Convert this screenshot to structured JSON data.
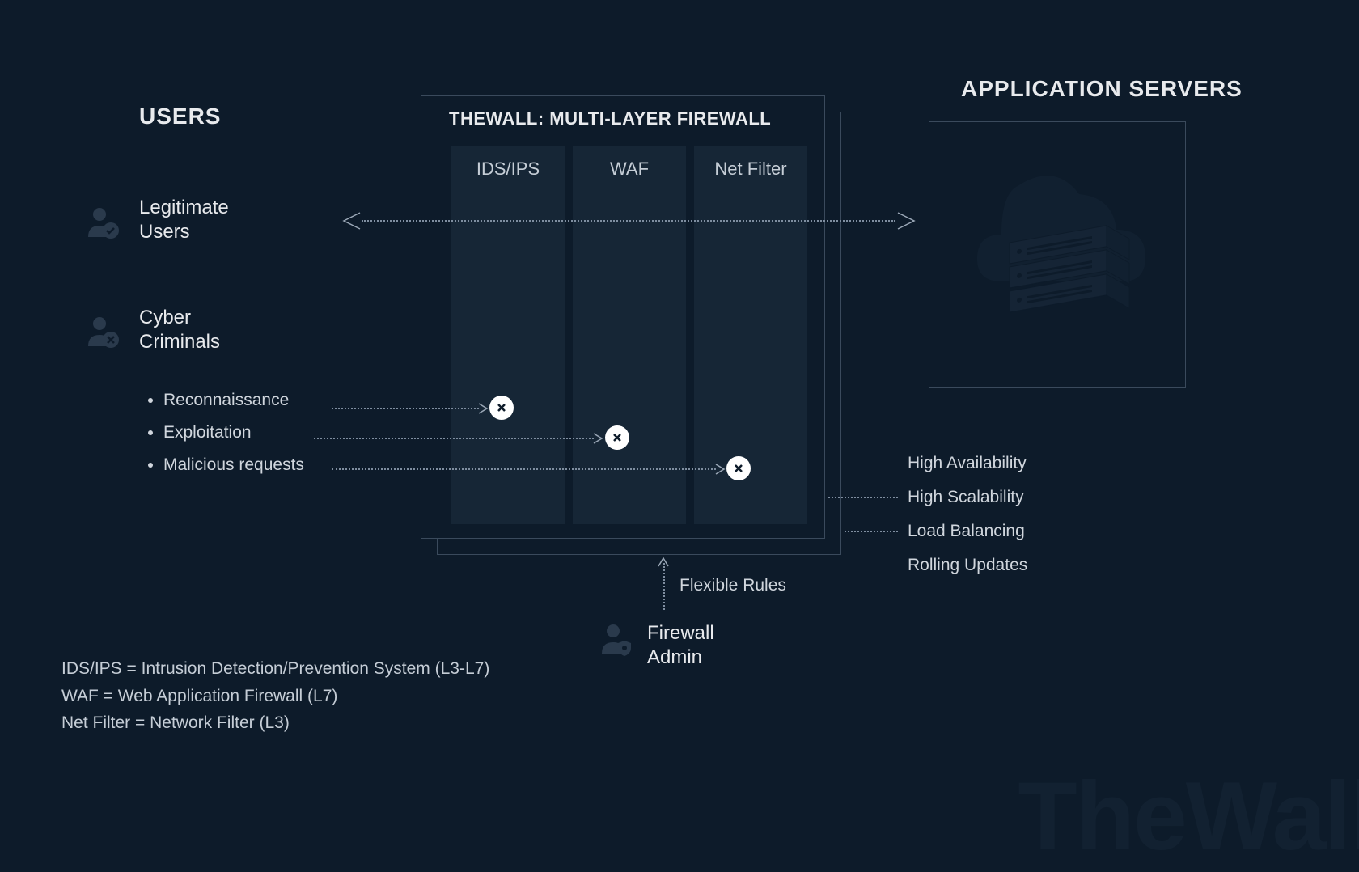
{
  "headings": {
    "users": "USERS",
    "firewall": "THEWALL: MULTI-LAYER FIREWALL",
    "appServers": "APPLICATION SERVERS"
  },
  "layers": {
    "ids": "IDS/IPS",
    "waf": "WAF",
    "net": "Net Filter"
  },
  "users": {
    "legitimate": "Legitimate\nUsers",
    "criminals": "Cyber\nCriminals"
  },
  "attacks": {
    "recon": "Reconnaissance",
    "exploit": "Exploitation",
    "malicious": "Malicious requests"
  },
  "admin": {
    "label": "Firewall\nAdmin",
    "flexRules": "Flexible Rules"
  },
  "features": {
    "ha": "High Availability",
    "hs": "High Scalability",
    "lb": "Load Balancing",
    "ru": "Rolling Updates"
  },
  "legend": {
    "ids": "IDS/IPS = Intrusion Detection/Prevention System (L3-L7)",
    "waf": "WAF = Web Application Firewall (L7)",
    "net": "Net Filter = Network Filter (L3)"
  },
  "watermark": "TheWall"
}
